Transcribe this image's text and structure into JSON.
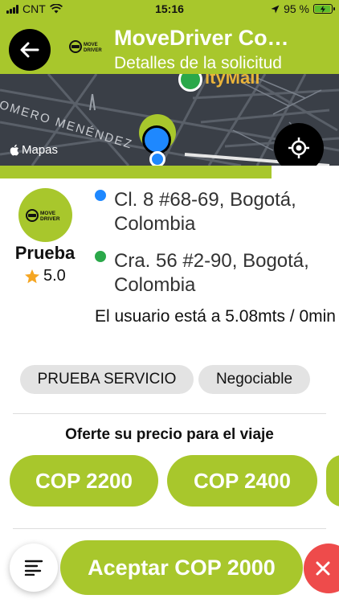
{
  "status_bar": {
    "carrier": "CNT",
    "time": "15:16",
    "battery": "95 %",
    "battery_level": 0.95
  },
  "header": {
    "title": "MoveDriver Co…",
    "subtitle": "Detalles de la solicitud",
    "logo_text": "MOVE DRIVER"
  },
  "map": {
    "street_label": "OMERO MENÉNDEZ",
    "place_label": "ityMall",
    "brand": "Mapas"
  },
  "progress": {
    "fraction": 0.8
  },
  "passenger": {
    "name": "Prueba",
    "rating": "5.0",
    "avatar_text": "MOVE DRIVER"
  },
  "trip": {
    "pickup": "Cl. 8 #68-69, Bogotá, Colombia",
    "dropoff": "Cra. 56 #2-90, Bogotá, Colombia",
    "distance": "El usuario está a 5.08mts / 0min",
    "pickup_color": "#1e88ff",
    "dropoff_color": "#2ba84a"
  },
  "tags": [
    "PRUEBA SERVICIO",
    "Negociable"
  ],
  "offer": {
    "title": "Oferte su precio para el viaje",
    "prices": [
      "COP 2200",
      "COP 2400",
      ""
    ]
  },
  "actions": {
    "accept_label": "Aceptar COP 2000"
  },
  "colors": {
    "brand_green": "#a8c72c",
    "danger": "#ee4b4b"
  }
}
